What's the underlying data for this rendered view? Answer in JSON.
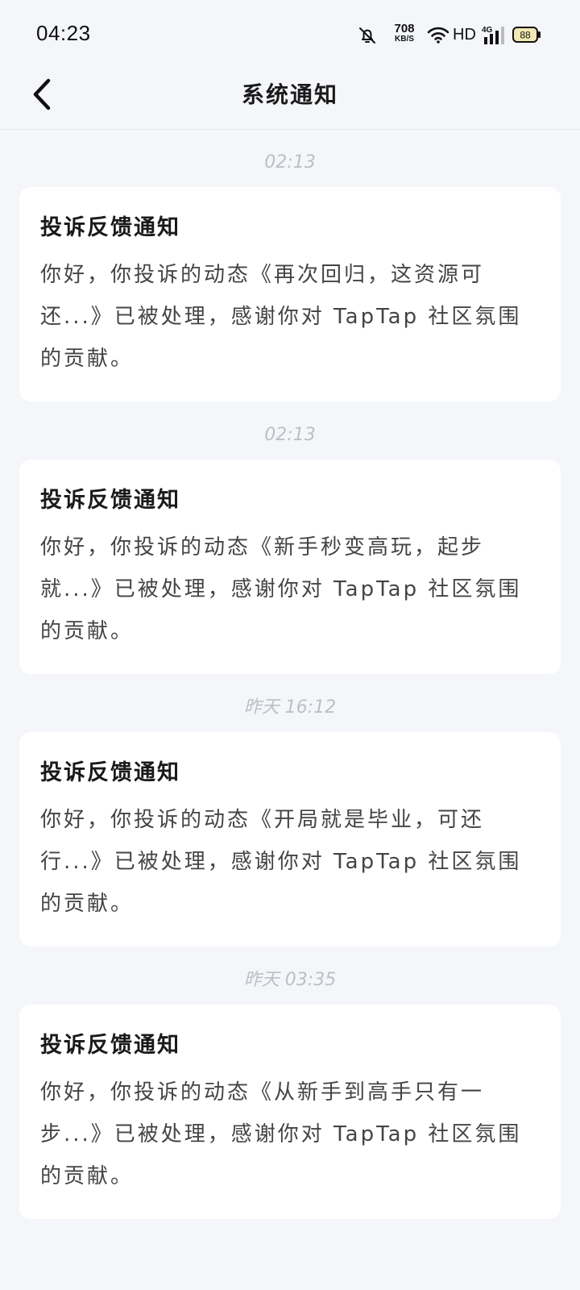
{
  "status_bar": {
    "time": "04:23",
    "net_speed": "708",
    "net_unit": "KB/S",
    "hd": "HD",
    "network": "4G",
    "battery": "88"
  },
  "header": {
    "title": "系统通知"
  },
  "notifications": [
    {
      "time": "02:13",
      "title": "投诉反馈通知",
      "body": "你好，你投诉的动态《再次回归，这资源可还...》已被处理，感谢你对 TapTap 社区氛围的贡献。"
    },
    {
      "time": "02:13",
      "title": "投诉反馈通知",
      "body": "你好，你投诉的动态《新手秒变高玩，起步就...》已被处理，感谢你对 TapTap 社区氛围的贡献。"
    },
    {
      "time": "昨天  16:12",
      "title": "投诉反馈通知",
      "body": "你好，你投诉的动态《开局就是毕业，可还行...》已被处理，感谢你对 TapTap 社区氛围的贡献。"
    },
    {
      "time": "昨天  03:35",
      "title": "投诉反馈通知",
      "body": "你好，你投诉的动态《从新手到高手只有一步...》已被处理，感谢你对 TapTap 社区氛围的贡献。"
    }
  ]
}
